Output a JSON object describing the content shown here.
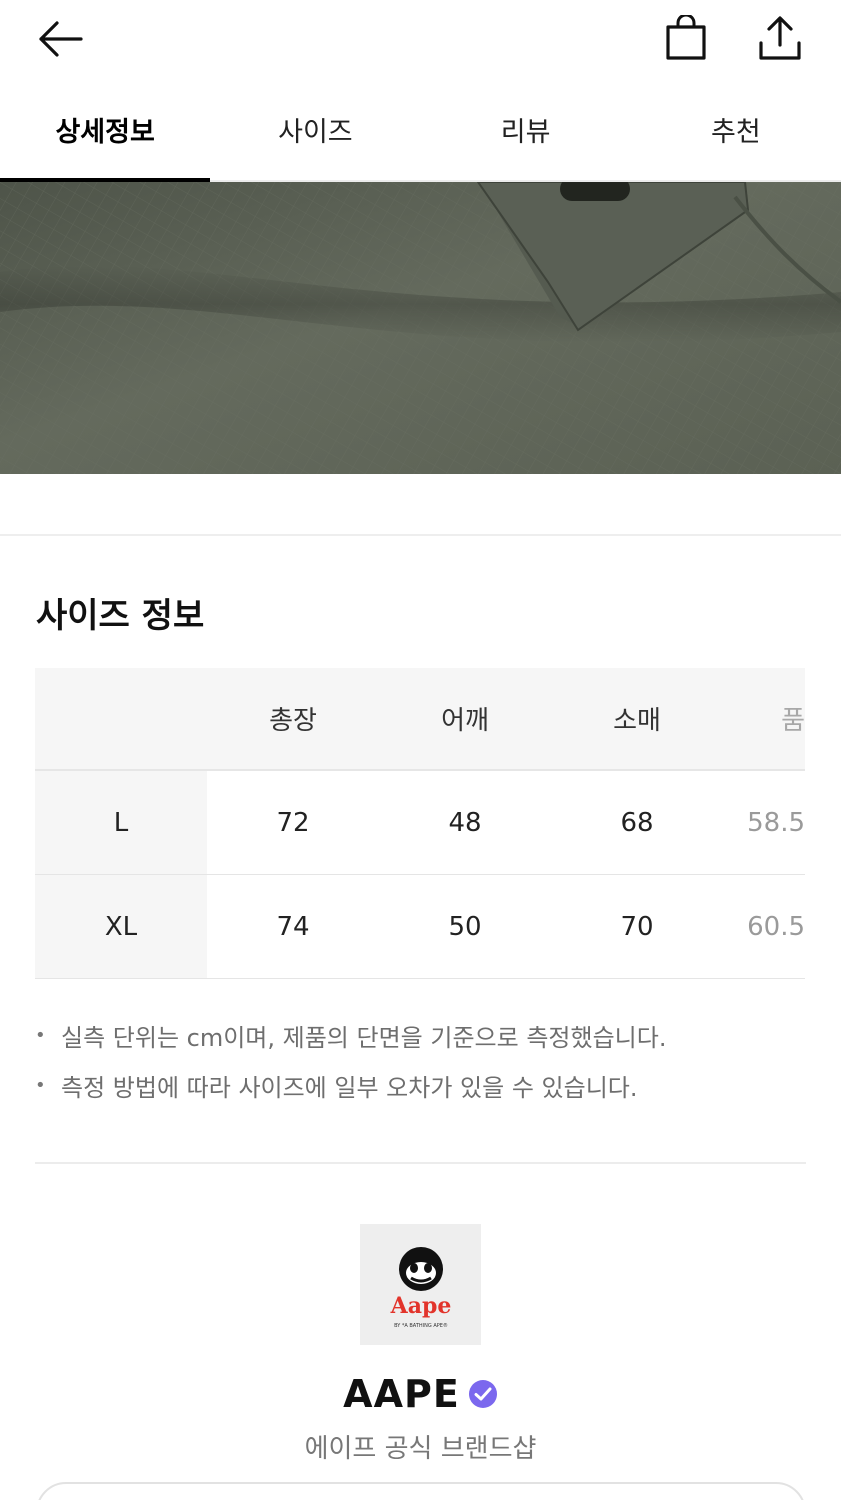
{
  "header": {
    "back_icon": "arrow-left-icon",
    "bag_icon": "shopping-bag-icon",
    "share_icon": "share-upload-icon"
  },
  "tabs": [
    {
      "label": "상세정보",
      "active": true
    },
    {
      "label": "사이즈",
      "active": false
    },
    {
      "label": "리뷰",
      "active": false
    },
    {
      "label": "추천",
      "active": false
    }
  ],
  "size_section": {
    "title": "사이즈 정보",
    "columns": [
      "총장",
      "어깨",
      "소매",
      "품"
    ],
    "rows": [
      {
        "size": "L",
        "values": [
          "72",
          "48",
          "68",
          "58.5"
        ]
      },
      {
        "size": "XL",
        "values": [
          "74",
          "50",
          "70",
          "60.5"
        ]
      }
    ],
    "notes": [
      "실측 단위는 cm이며, 제품의 단면을 기준으로 측정했습니다.",
      "측정 방법에 따라 사이즈에 일부 오차가 있을 수 있습니다."
    ]
  },
  "brand": {
    "logo_text": "Aape",
    "logo_subtext": "BY *A BATHING APE®",
    "name": "AAPE",
    "subtitle": "에이프 공식 브랜드샵",
    "verified_icon": "verified-check-icon"
  },
  "colors": {
    "accent_verified": "#7b68ee",
    "fabric": "#5f6558",
    "logo_red": "#e2342b"
  }
}
